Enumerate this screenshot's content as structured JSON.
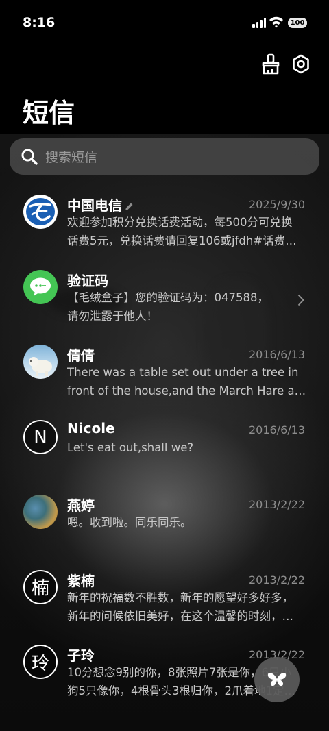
{
  "status_bar": {
    "time": "8:16",
    "battery": "100",
    "signal_icon": "cellular-signal-icon",
    "wifi_icon": "wifi-icon"
  },
  "header": {
    "title": "短信",
    "clean_icon": "broom-icon",
    "settings_icon": "gear-icon"
  },
  "search": {
    "placeholder": "搜索短信",
    "icon": "search-icon"
  },
  "conversations": [
    {
      "name": "中国电信",
      "date": "2025/9/30",
      "line1": "欢迎参加积分兑换话费活动，每500分可兑换",
      "line2": "话费5元，兑换话费请回复106或jfdh#话费…",
      "avatar": "china-telecom-logo",
      "edit_icon": "pencil-icon"
    },
    {
      "name": "验证码",
      "date": "",
      "line1": "【毛绒盒子】您的验证码为：047588，",
      "line2": "请勿泄露于他人！",
      "avatar": "message-bubble-icon",
      "chevron_icon": "chevron-right-icon"
    },
    {
      "name": "倩倩",
      "date": "2016/6/13",
      "line1": "There was a table set out under a tree in",
      "line2": "front of the house,and the March Hare an…",
      "avatar": "polar-bear-photo"
    },
    {
      "name": "Nicole",
      "date": "2016/6/13",
      "line1": "Let's eat out,shall we?",
      "line2": "",
      "avatar_letter": "N"
    },
    {
      "name": "燕婷",
      "date": "2013/2/22",
      "line1": "嗯。收到啦。同乐同乐。",
      "line2": "",
      "avatar": "landscape-photo"
    },
    {
      "name": "紫楠",
      "date": "2013/2/22",
      "line1": "新年的祝福数不胜数，新年的愿望好多好多，",
      "line2": "新年的问候依旧美好，在这个温馨的时刻，…",
      "avatar_letter": "楠"
    },
    {
      "name": "子玲",
      "date": "2013/2/22",
      "line1": "10分想念9别的你，8张照片7张是你，6只小",
      "line2": "狗5只像你，4根骨头3根归你，2爪着地1定…",
      "avatar_letter": "玲"
    }
  ],
  "fab": {
    "icon": "butterfly-icon"
  },
  "colors": {
    "background": "#000000",
    "search_bg": "#464646",
    "secondary_text": "#8d8d8d",
    "wechat_green": "#44c554",
    "telecom_blue": "#1a5fb4"
  }
}
